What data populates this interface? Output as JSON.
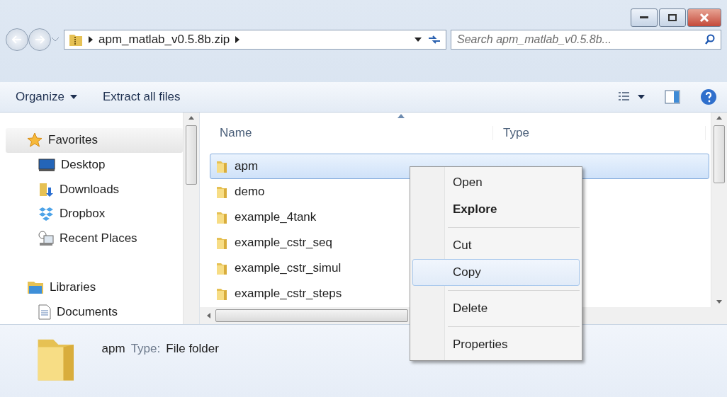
{
  "address": {
    "path": "apm_matlab_v0.5.8b.zip"
  },
  "search": {
    "placeholder": "Search apm_matlab_v0.5.8b..."
  },
  "toolbar": {
    "buttons": [
      {
        "label": "Organize",
        "kind": "menu"
      },
      {
        "label": "Extract all files",
        "kind": "plain"
      }
    ]
  },
  "sidebar": {
    "groups": [
      {
        "label": "Favorites",
        "selected": true,
        "children": [
          {
            "label": "Desktop",
            "selected": false
          },
          {
            "label": "Downloads",
            "selected": false
          },
          {
            "label": "Dropbox",
            "selected": false
          },
          {
            "label": "Recent Places",
            "selected": false
          }
        ]
      },
      {
        "label": "Libraries",
        "selected": false,
        "children": [
          {
            "label": "Documents",
            "selected": false
          }
        ]
      }
    ]
  },
  "table": {
    "columns": [
      {
        "label": "Name",
        "sorted": true
      },
      {
        "label": "Type",
        "sorted": false
      }
    ],
    "rows": [
      {
        "name": "apm",
        "selected": true
      },
      {
        "name": "demo",
        "selected": false
      },
      {
        "name": "example_4tank",
        "selected": false
      },
      {
        "name": "example_cstr_seq",
        "selected": false
      },
      {
        "name": "example_cstr_simul",
        "selected": false
      },
      {
        "name": "example_cstr_steps",
        "selected": false
      }
    ]
  },
  "context_menu": {
    "items": [
      {
        "kind": "item",
        "label": "Open",
        "bold": false,
        "selected": false
      },
      {
        "kind": "item",
        "label": "Explore",
        "bold": true,
        "selected": false
      },
      {
        "kind": "separator"
      },
      {
        "kind": "item",
        "label": "Cut",
        "bold": false,
        "selected": false
      },
      {
        "kind": "item",
        "label": "Copy",
        "bold": false,
        "selected": true
      },
      {
        "kind": "separator"
      },
      {
        "kind": "item",
        "label": "Delete",
        "bold": false,
        "selected": false
      },
      {
        "kind": "separator"
      },
      {
        "kind": "item",
        "label": "Properties",
        "bold": false,
        "selected": false
      }
    ]
  },
  "details": {
    "name": "apm",
    "type_label": "Type:",
    "type": "File folder"
  }
}
